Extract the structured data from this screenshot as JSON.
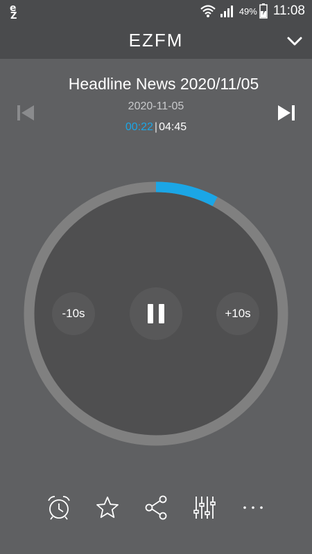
{
  "status_bar": {
    "battery_percent": "49%",
    "time": "11:08",
    "icons": [
      "app-logo-icon",
      "wifi-icon",
      "signal-icon",
      "battery-charging-icon"
    ]
  },
  "header": {
    "title": "EZFM",
    "collapse_icon": "chevron-down-icon"
  },
  "player": {
    "episode_title": "Headline News 2020/11/05",
    "episode_date": "2020-11-05",
    "elapsed": "00:22",
    "separator": "|",
    "duration": "04:45",
    "progress_fraction": 0.077,
    "rewind_label": "-10s",
    "forward_label": "+10s",
    "play_state_icon": "pause-icon",
    "prev_icon": "skip-previous-icon",
    "next_icon": "skip-next-icon"
  },
  "colors": {
    "background": "#5f6062",
    "header": "#4a4b4d",
    "dial": "#4f4f50",
    "ring_track": "#808080",
    "accent": "#1ba6e6"
  },
  "toolbar": {
    "items": [
      "alarm-clock-icon",
      "star-icon",
      "share-icon",
      "equalizer-icon",
      "more-icon"
    ]
  }
}
